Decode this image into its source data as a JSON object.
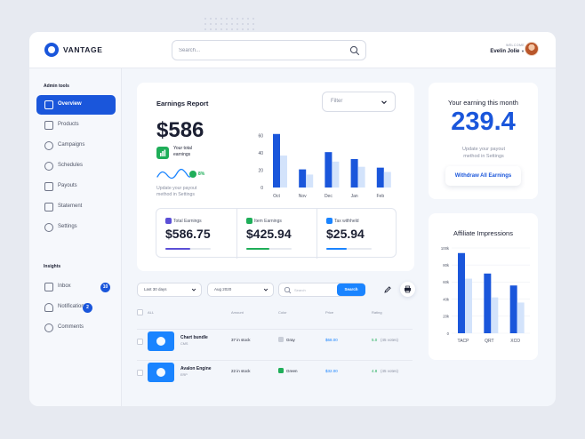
{
  "brand": {
    "name": "VANTAGE",
    "accent": "#1a56db"
  },
  "header": {
    "search_placeholder": "Search...",
    "welcome": "WELCOME",
    "user_name": "Evelin Jolie"
  },
  "sidebar": {
    "admin_title": "Admin tools",
    "admin_items": [
      {
        "label": "Overview",
        "icon": "chart-icon",
        "active": true
      },
      {
        "label": "Products",
        "icon": "bag-icon"
      },
      {
        "label": "Campaigns",
        "icon": "megaphone-icon"
      },
      {
        "label": "Schedules",
        "icon": "clock-icon"
      },
      {
        "label": "Payouts",
        "icon": "wallet-icon"
      },
      {
        "label": "Statement",
        "icon": "document-icon"
      },
      {
        "label": "Settings",
        "icon": "gear-icon"
      }
    ],
    "insights_title": "Insights",
    "insight_items": [
      {
        "label": "Inbox",
        "icon": "mail-icon",
        "badge": "10"
      },
      {
        "label": "Notifications",
        "icon": "bell-icon",
        "badge": "2"
      },
      {
        "label": "Comments",
        "icon": "comment-icon"
      }
    ]
  },
  "earnings": {
    "title": "Earnings Report",
    "filter_label": "Filter",
    "amount": "$586",
    "note": "Your total earnings",
    "percent": "8%",
    "sub": "Update your payout method in Settings",
    "stats": [
      {
        "label": "Total Earnings",
        "value": "$586.75",
        "color": "#5b4fd6",
        "progress": 0.55
      },
      {
        "label": "Item Earnings",
        "value": "$425.94",
        "color": "#1fae59",
        "progress": 0.5
      },
      {
        "label": "Tax withheld",
        "value": "$25.94",
        "color": "#1a84ff",
        "progress": 0.45
      }
    ]
  },
  "month": {
    "title": "Your earning this month",
    "value": "239.4",
    "note": "Update your payout method in Settings",
    "button": "Withdraw All Earnings"
  },
  "affiliate": {
    "title": "Affiliate Impressions"
  },
  "controls": {
    "range": "Last 30 days",
    "month": "Aug 2020",
    "search_placeholder": "Search",
    "search_button": "Search"
  },
  "table": {
    "headers": [
      "ALL",
      "Amount",
      "Color",
      "Price",
      "Rating"
    ],
    "rows": [
      {
        "name": "Chart bundle",
        "category": "CMS",
        "amount": "37 in stock",
        "color": "Gray",
        "swatch": "#c9ced8",
        "price": "$68.00",
        "rating": "5.0",
        "votes": "(45 votes)"
      },
      {
        "name": "Avalon Engine",
        "category": "ERP",
        "amount": "22 in stock",
        "color": "Green",
        "swatch": "#1fae59",
        "price": "$32.00",
        "rating": "4.8",
        "votes": "(45 votes)"
      }
    ]
  },
  "chart_data": [
    {
      "type": "bar",
      "categories": [
        "Oct",
        "Nov",
        "Dec",
        "Jan",
        "Feb"
      ],
      "series": [
        {
          "values": [
            62,
            21,
            41,
            33,
            23
          ],
          "color": "#1a56db"
        },
        {
          "values": [
            37,
            15,
            30,
            24,
            18
          ],
          "color": "#d3e3fb"
        }
      ],
      "yticks": [
        0,
        20,
        40,
        60
      ],
      "ylim": [
        0,
        70
      ],
      "grid": false
    },
    {
      "type": "bar",
      "title": "Affiliate Impressions",
      "categories": [
        "TACP",
        "QRT",
        "XCO"
      ],
      "series": [
        {
          "values": [
            94,
            70,
            56
          ],
          "color": "#1a56db"
        },
        {
          "values": [
            64,
            42,
            36
          ],
          "color": "#d3e3fb"
        }
      ],
      "yticks": [
        "0",
        "20k",
        "40k",
        "60k",
        "80k",
        "100k"
      ],
      "ylim": [
        0,
        100
      ],
      "ylabel_unit": "k",
      "grid": true
    }
  ]
}
